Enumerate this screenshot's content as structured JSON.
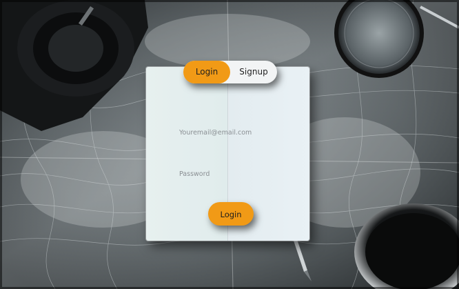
{
  "auth": {
    "tabs": {
      "login_label": "Login",
      "signup_label": "Signup",
      "active": "login"
    },
    "email_placeholder": "Youremail@email.com",
    "password_placeholder": "Password",
    "submit_label": "Login"
  },
  "background": {
    "description_icon": "topographic-map-background"
  },
  "colors": {
    "accent": "#f19a16",
    "card": "#e9f0f3",
    "tab_inactive": "#f2f4f5"
  }
}
